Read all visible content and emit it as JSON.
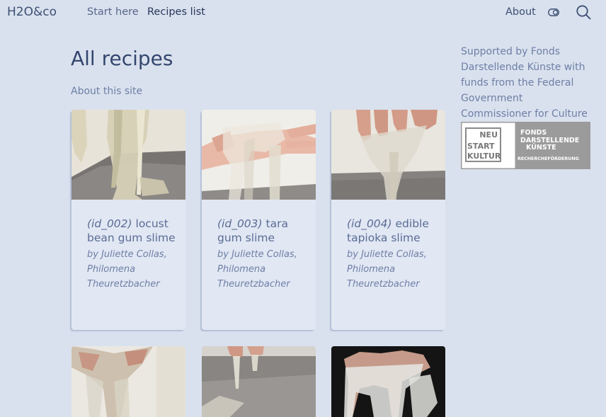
{
  "header": {
    "brand": "H2O&co",
    "nav": {
      "start": "Start here",
      "recipes": "Recipes list",
      "about": "About"
    },
    "icons": [
      "toggle-icon",
      "search-icon"
    ]
  },
  "main": {
    "title": "All recipes",
    "about_link": "About this site",
    "cards": [
      {
        "id_label": "(id_002)",
        "name": "locust bean gum slime",
        "authors": "by Juliette Collas, Philomena Theuretzbacher"
      },
      {
        "id_label": "(id_003)",
        "name": "tara gum slime",
        "authors": "by Juliette Collas, Philomena Theuretzbacher"
      },
      {
        "id_label": "(id_004)",
        "name": "edible tapioka slime",
        "authors": "by Juliette Collas, Philomena Theuretzbacher"
      }
    ]
  },
  "sidebar": {
    "support_text": "Supported by Fonds Darstellende Künste with funds from the Federal Government Commissioner for Culture and the Media.",
    "logo": {
      "left_lines": [
        "NEU",
        "START",
        "KULTUR"
      ],
      "right_lines": [
        "FONDS",
        "DARSTELLENDE",
        "KÜNSTE"
      ],
      "tagline": "RECHERCHEFÖRDERUNG"
    }
  },
  "colors": {
    "background": "#d9e1ee",
    "card": "#e1e7f3",
    "text": "#3d4f73",
    "muted": "#6e7fa6"
  }
}
